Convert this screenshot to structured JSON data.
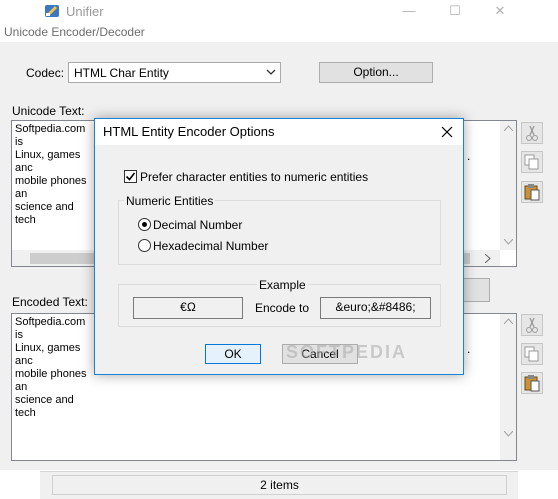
{
  "main_window": {
    "title": "Unifier",
    "min_glyph": "—",
    "max_glyph": "☐",
    "close_glyph": "✕",
    "icon": "app-icon"
  },
  "coder_window": {
    "title": "Unicode Encoder/Decoder",
    "codec_label": "Codec:",
    "codec_value": "HTML Char Entity",
    "option_button": "Option...",
    "unicode_label": "Unicode Text:",
    "encoded_label": "Encoded Text:",
    "unicode_text": "Softpedia.com is\nLinux, games anc\nmobile phones an\nscience and tech",
    "encoded_text": "Softpedia.com is\nLinux, games anc\nmobile phones an\nscience and tech",
    "right_trailing_dot_top": ".",
    "right_trailing_dot_bottom": ".",
    "side_icons": [
      "cut-icon",
      "copy-icon",
      "paste-icon"
    ]
  },
  "status_bar": {
    "items_text": "2 items"
  },
  "dialog": {
    "title": "HTML Entity Encoder Options",
    "prefer_checkbox_label": "Prefer character entities to numeric entities",
    "prefer_checked": true,
    "numeric_group_label": "Numeric Entities",
    "radio_decimal": "Decimal Number",
    "radio_hex": "Hexadecimal Number",
    "selected_radio": "decimal",
    "example_group_label": "Example",
    "example_input": "€Ω",
    "encode_to_label": "Encode to",
    "example_output": "&euro;&#8486;",
    "ok_button": "OK",
    "cancel_button": "Cancel",
    "watermark": "SOFTPEDIA"
  }
}
